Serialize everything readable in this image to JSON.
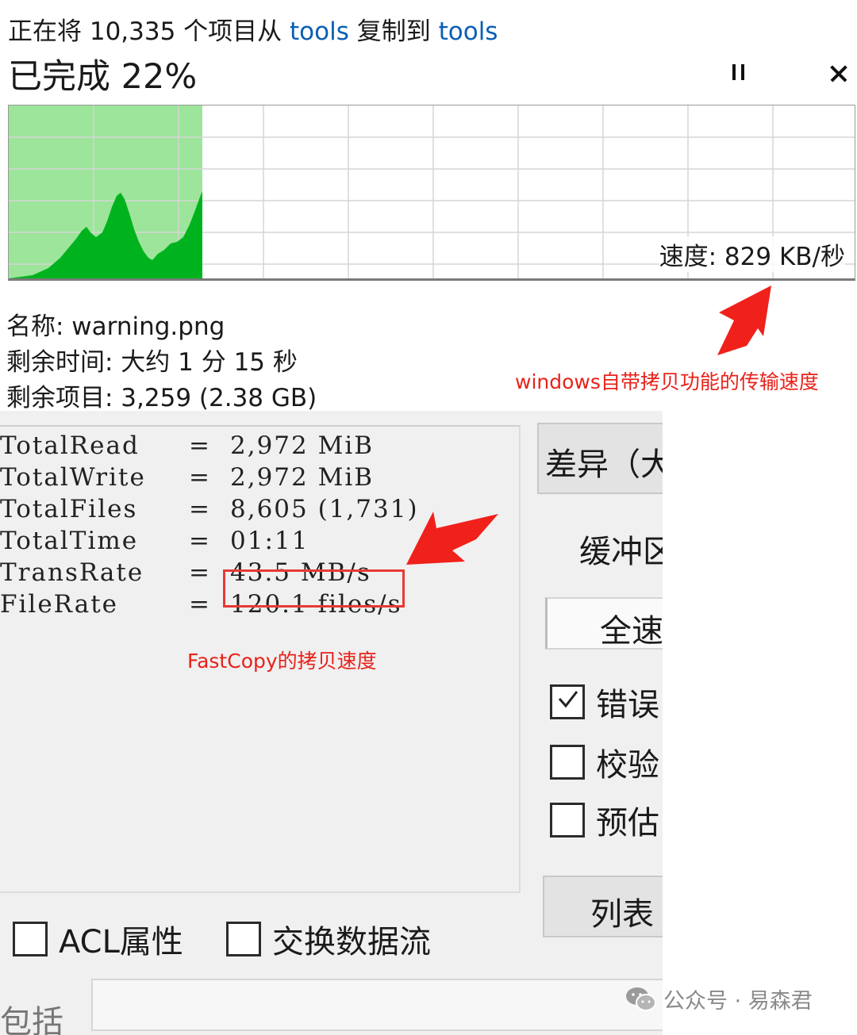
{
  "copy_dialog": {
    "header_prefix": "正在将 10,335 个项目从 ",
    "source": "tools",
    "header_middle": " 复制到 ",
    "destination": "tools",
    "percent_complete_text": "已完成 22%",
    "progress_fraction": 0.22,
    "speed_text": "速度: 829 KB/秒",
    "name_text": "名称: warning.png",
    "time_remaining_text": "剩余时间: 大约 1 分 15 秒",
    "items_remaining_text": "剩余项目: 3,259 (2.38 GB)",
    "icons": [
      "pause-icon",
      "close-icon"
    ],
    "graph_fill_color": "#00b31e",
    "graph_background_fill_color": "#9ce59a"
  },
  "annotations": {
    "windows_speed": "windows自带拷贝功能的传输速度",
    "fastcopy_speed": "FastCopy的拷贝速度",
    "color": "#e8221a"
  },
  "fastcopy": {
    "stats": [
      {
        "key": "TotalRead",
        "value": "2,972 MiB"
      },
      {
        "key": "TotalWrite",
        "value": "2,972 MiB"
      },
      {
        "key": "TotalFiles",
        "value": "8,605 (1,731)"
      },
      {
        "key": "TotalTime",
        "value": "01:11"
      },
      {
        "key": "TransRate",
        "value": "43.5 MB/s"
      },
      {
        "key": "FileRate",
        "value": "120.1 files/s"
      }
    ],
    "diff_button": "差异（大",
    "buffer_label": "缓冲区",
    "speed_button": "全速",
    "checkboxes": {
      "error": {
        "label": "错误",
        "checked": true
      },
      "verify": {
        "label": "校验",
        "checked": false
      },
      "estimate": {
        "label": "预估",
        "checked": false
      },
      "acl": {
        "label": "ACL属性",
        "checked": false
      },
      "stream": {
        "label": "交换数据流",
        "checked": false
      }
    },
    "list_button": "列表",
    "include_label": "包括"
  },
  "watermark": {
    "text": "公众号 · 易森君",
    "icon": "wechat-icon"
  }
}
